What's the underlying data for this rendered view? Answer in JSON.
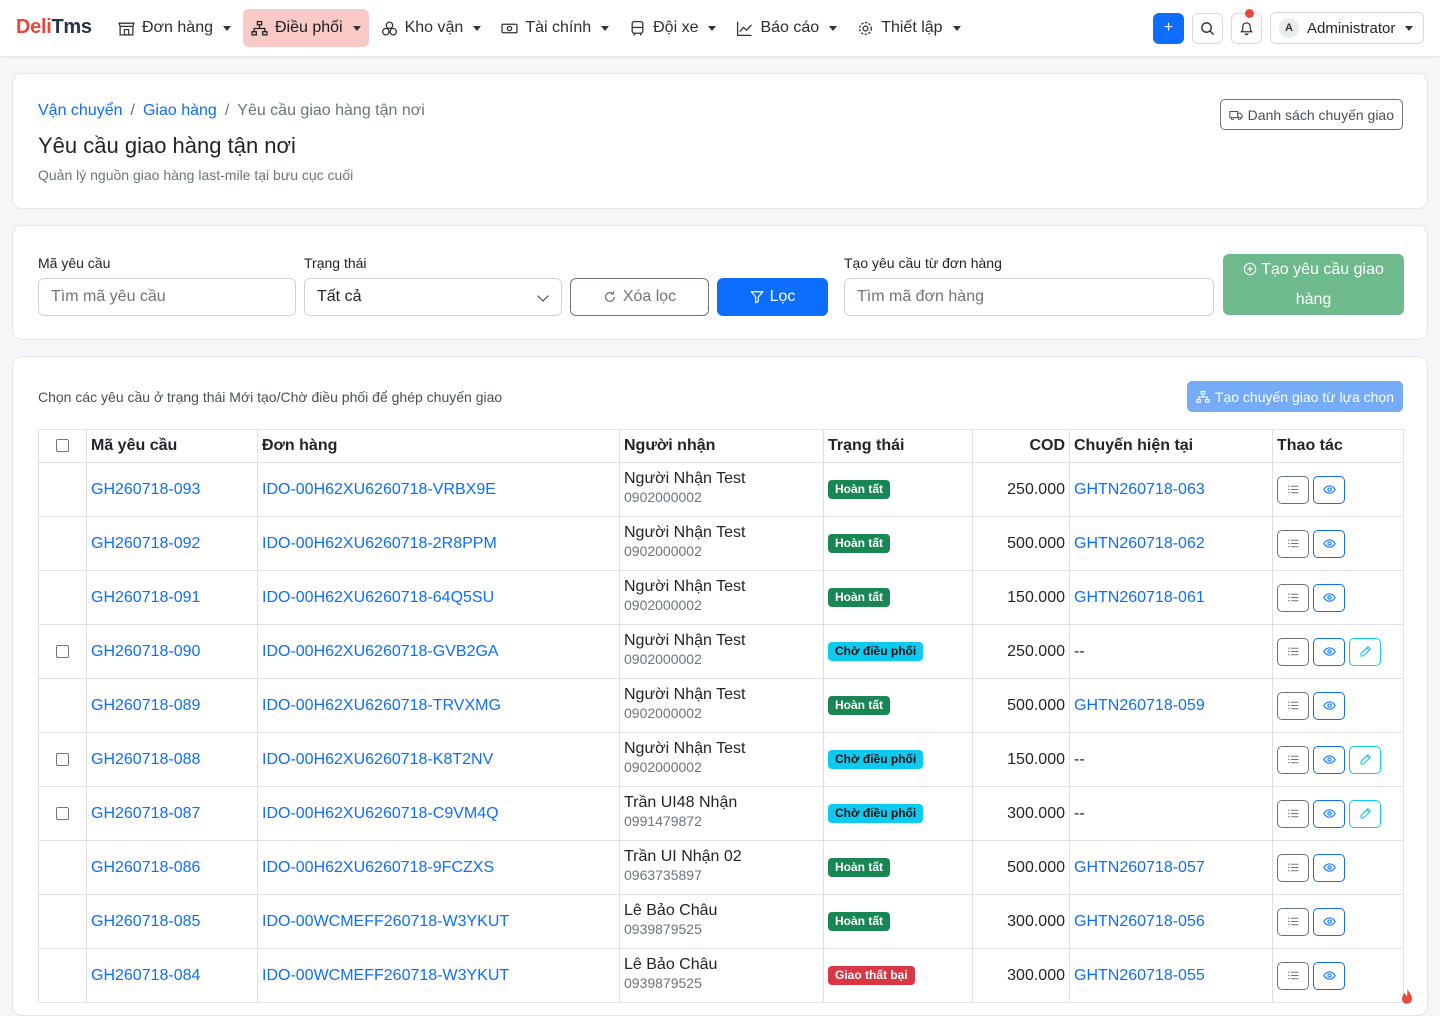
{
  "brand": {
    "part1": "Deli",
    "part2": "Tms"
  },
  "nav": [
    {
      "label": "Đơn hàng",
      "icon": "store-icon"
    },
    {
      "label": "Điều phối",
      "icon": "sitemap-icon",
      "active": true
    },
    {
      "label": "Kho vận",
      "icon": "boxes-icon"
    },
    {
      "label": "Tài chính",
      "icon": "cash-icon"
    },
    {
      "label": "Đội xe",
      "icon": "bus-icon"
    },
    {
      "label": "Báo cáo",
      "icon": "chart-line-icon"
    },
    {
      "label": "Thiết lập",
      "icon": "gear-icon"
    }
  ],
  "topbar": {
    "add_label": "+",
    "user_initial": "A",
    "user_name": "Administrator"
  },
  "header": {
    "breadcrumb": [
      "Vận chuyển",
      "Giao hàng",
      "Yêu cầu giao hàng tận nơi"
    ],
    "title": "Yêu cầu giao hàng tận nơi",
    "subtitle": "Quản lý nguồn giao hàng last-mile tại bưu cục cuối",
    "transfer_list_btn": "Danh sách chuyến giao"
  },
  "filters": {
    "code_label": "Mã yêu cầu",
    "code_placeholder": "Tìm mã yêu cầu",
    "status_label": "Trạng thái",
    "status_value": "Tất cả",
    "clear_btn": "Xóa lọc",
    "filter_btn": "Lọc",
    "from_order_label": "Tạo yêu cầu từ đơn hàng",
    "from_order_placeholder": "Tìm mã đơn hàng",
    "create_btn_line1": "Tạo yêu cầu giao",
    "create_btn_line2": "hàng"
  },
  "list": {
    "note": "Chọn các yêu cầu ở trạng thái Mới tạo/Chờ điều phối để ghép chuyến giao",
    "create_trip_btn": "Tạo chuyến giao từ lựa chọn",
    "columns": [
      "Mã yêu cầu",
      "Đơn hàng",
      "Người nhận",
      "Trạng thái",
      "COD",
      "Chuyến hiện tại",
      "Thao tác"
    ],
    "rows": [
      {
        "code": "GH260718-093",
        "order": "IDO-00H62XU6260718-VRBX9E",
        "name": "Người Nhận Test",
        "phone": "0902000002",
        "status": "Hoàn tất",
        "kind": "done",
        "cod": "250.000",
        "trip": "GHTN260718-063",
        "checkbox": false,
        "edit": false
      },
      {
        "code": "GH260718-092",
        "order": "IDO-00H62XU6260718-2R8PPM",
        "name": "Người Nhận Test",
        "phone": "0902000002",
        "status": "Hoàn tất",
        "kind": "done",
        "cod": "500.000",
        "trip": "GHTN260718-062",
        "checkbox": false,
        "edit": false
      },
      {
        "code": "GH260718-091",
        "order": "IDO-00H62XU6260718-64Q5SU",
        "name": "Người Nhận Test",
        "phone": "0902000002",
        "status": "Hoàn tất",
        "kind": "done",
        "cod": "150.000",
        "trip": "GHTN260718-061",
        "checkbox": false,
        "edit": false
      },
      {
        "code": "GH260718-090",
        "order": "IDO-00H62XU6260718-GVB2GA",
        "name": "Người Nhận Test",
        "phone": "0902000002",
        "status": "Chờ điều phối",
        "kind": "wait",
        "cod": "250.000",
        "trip": "--",
        "checkbox": true,
        "edit": true
      },
      {
        "code": "GH260718-089",
        "order": "IDO-00H62XU6260718-TRVXMG",
        "name": "Người Nhận Test",
        "phone": "0902000002",
        "status": "Hoàn tất",
        "kind": "done",
        "cod": "500.000",
        "trip": "GHTN260718-059",
        "checkbox": false,
        "edit": false
      },
      {
        "code": "GH260718-088",
        "order": "IDO-00H62XU6260718-K8T2NV",
        "name": "Người Nhận Test",
        "phone": "0902000002",
        "status": "Chờ điều phối",
        "kind": "wait",
        "cod": "150.000",
        "trip": "--",
        "checkbox": true,
        "edit": true
      },
      {
        "code": "GH260718-087",
        "order": "IDO-00H62XU6260718-C9VM4Q",
        "name": "Trần UI48 Nhận",
        "phone": "0991479872",
        "status": "Chờ điều phối",
        "kind": "wait",
        "cod": "300.000",
        "trip": "--",
        "checkbox": true,
        "edit": true
      },
      {
        "code": "GH260718-086",
        "order": "IDO-00H62XU6260718-9FCZXS",
        "name": "Trần UI Nhận 02",
        "phone": "0963735897",
        "status": "Hoàn tất",
        "kind": "done",
        "cod": "500.000",
        "trip": "GHTN260718-057",
        "checkbox": false,
        "edit": false
      },
      {
        "code": "GH260718-085",
        "order": "IDO-00WCMEFF260718-W3YKUT",
        "name": "Lê Bảo Châu",
        "phone": "0939879525",
        "status": "Hoàn tất",
        "kind": "done",
        "cod": "300.000",
        "trip": "GHTN260718-056",
        "checkbox": false,
        "edit": false
      },
      {
        "code": "GH260718-084",
        "order": "IDO-00WCMEFF260718-W3YKUT",
        "name": "Lê Bảo Châu",
        "phone": "0939879525",
        "status": "Giao thất bại",
        "kind": "fail",
        "cod": "300.000",
        "trip": "GHTN260718-055",
        "checkbox": false,
        "edit": false
      }
    ]
  },
  "colors": {
    "primary": "#0d6efd",
    "brand_red": "#e8483c",
    "success": "#198754",
    "info": "#0dcaf0",
    "danger": "#dc3545"
  }
}
